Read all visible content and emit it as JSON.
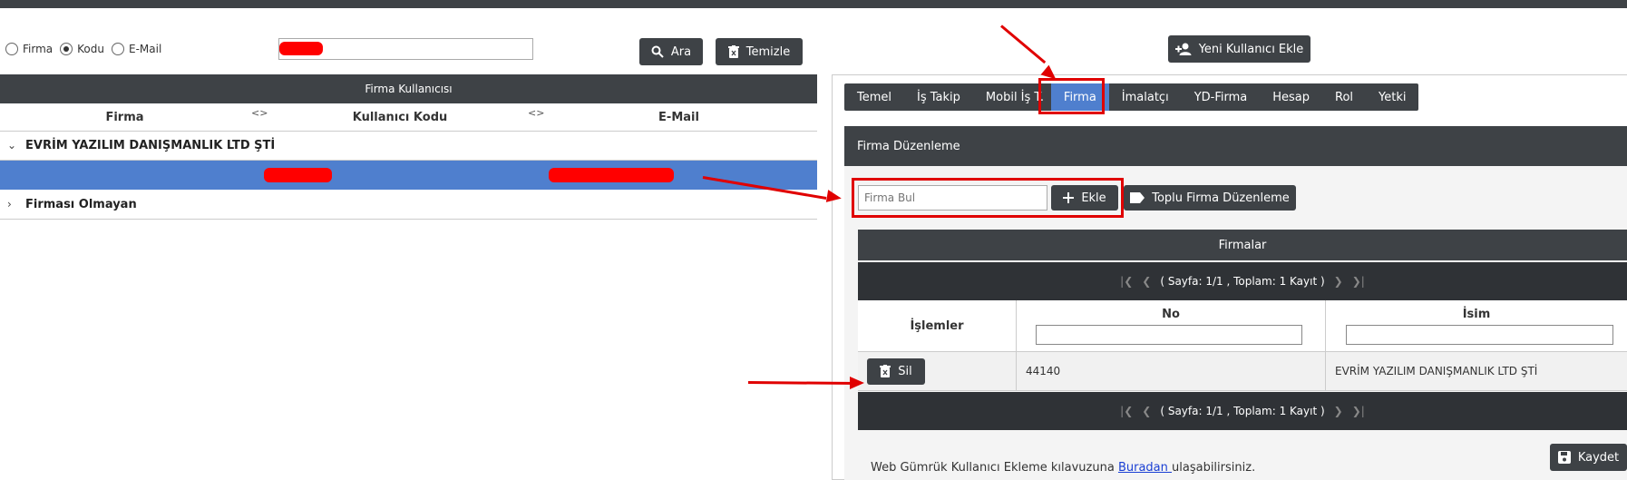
{
  "filter": {
    "options": [
      {
        "label": "Firma",
        "checked": false
      },
      {
        "label": "Kodu",
        "checked": true
      },
      {
        "label": "E-Mail",
        "checked": false
      }
    ],
    "search_value": "",
    "search_button": "Ara",
    "clear_button": "Temizle"
  },
  "new_user_button": "Yeni Kullanıcı Ekle",
  "left_table": {
    "title": "Firma Kullanıcısı",
    "columns": [
      "Firma",
      "Kullanıcı Kodu",
      "E-Mail"
    ],
    "sort_indicator": "<>",
    "groups": [
      {
        "label": "EVRİM YAZILIM DANIŞMANLIK LTD ŞTİ",
        "expanded": true
      },
      {
        "label": "Firması Olmayan",
        "expanded": false
      }
    ]
  },
  "tabs": [
    "Temel",
    "İş Takip",
    "Mobil İş T.",
    "Firma",
    "İmalatçı",
    "YD-Firma",
    "Hesap",
    "Rol",
    "Yetki"
  ],
  "active_tab": "Firma",
  "panel_title": "Firma Düzenleme",
  "firma_bul_placeholder": "Firma Bul",
  "add_button": "Ekle",
  "bulk_button": "Toplu Firma Düzenleme",
  "grid": {
    "title": "Firmalar",
    "pager_text": "( Sayfa: 1/1 , Toplam: 1 Kayıt )",
    "columns": [
      "İşlemler",
      "No",
      "İsim"
    ],
    "rows": [
      {
        "action": "Sil",
        "no": "44140",
        "isim": "EVRİM YAZILIM DANIŞMANLIK LTD ŞTİ"
      }
    ]
  },
  "save_button": "Kaydet",
  "footer": {
    "before": "Web Gümrük Kullanıcı Ekleme kılavuzuna ",
    "link": "Buradan ",
    "after": "ulaşabilirsiniz."
  },
  "colors": {
    "dark": "#3e4246",
    "accent": "#4f7fce",
    "annotation": "#e00000"
  }
}
